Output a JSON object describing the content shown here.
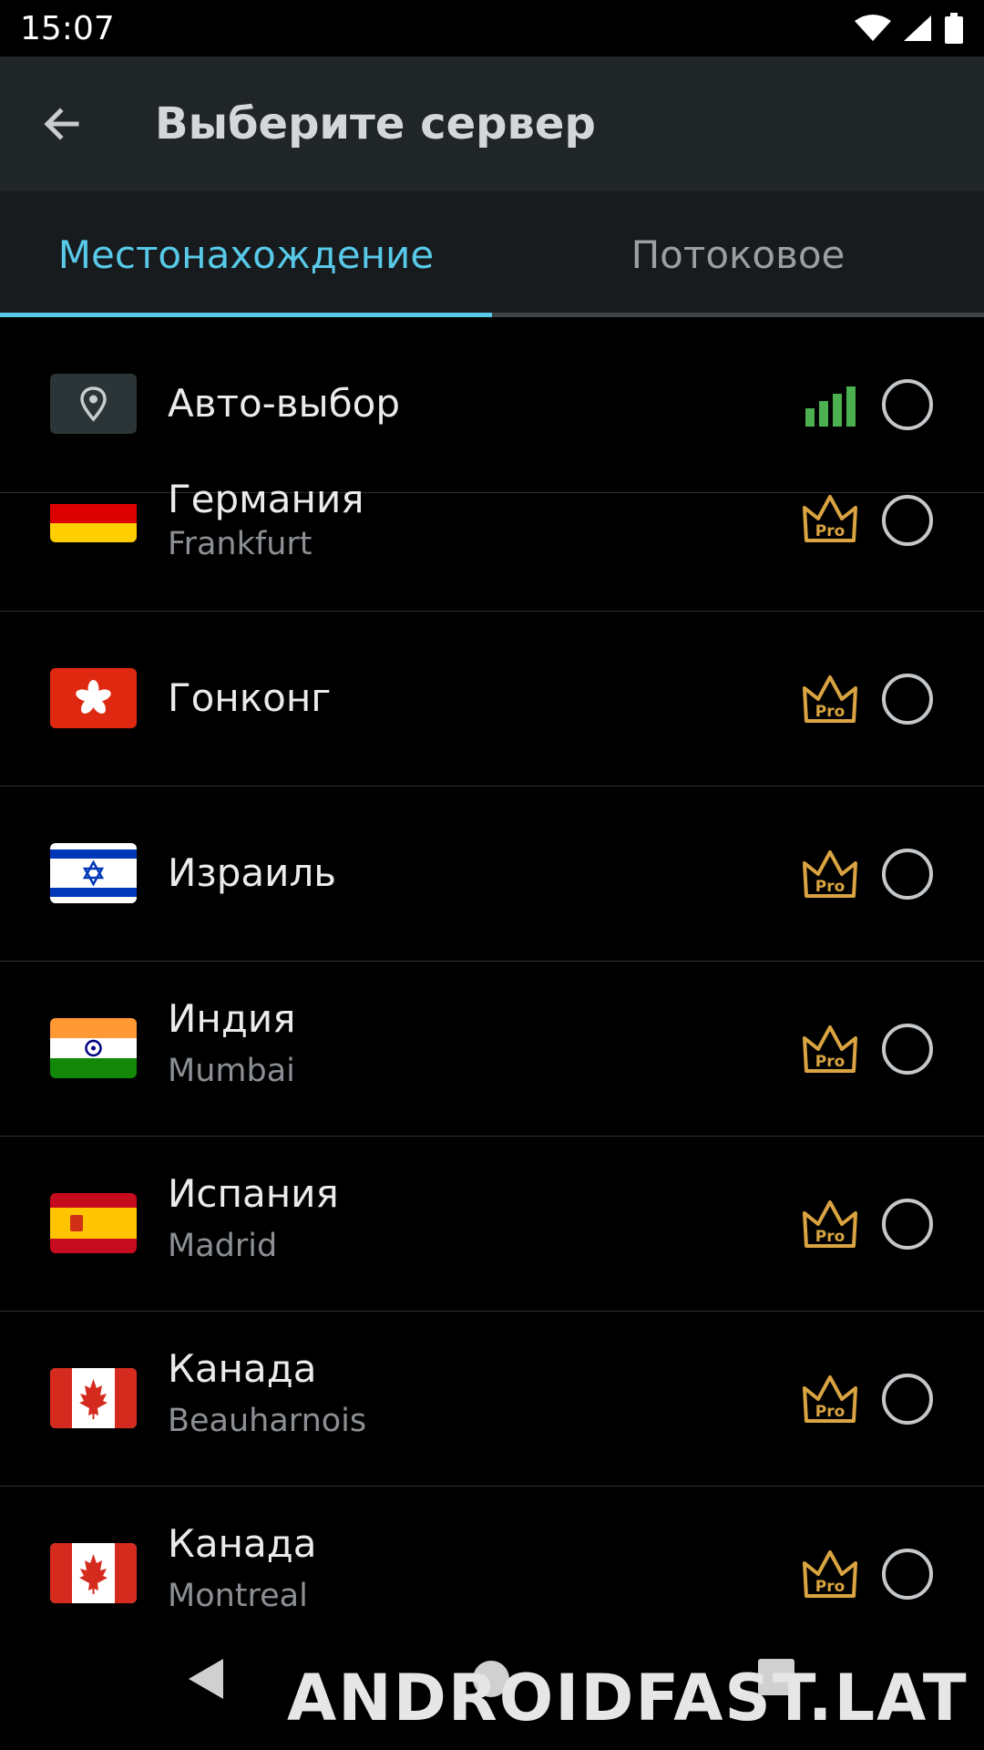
{
  "status_bar": {
    "time": "15:07",
    "icons": [
      "wifi-icon",
      "cell-signal-icon",
      "battery-icon"
    ]
  },
  "app_bar": {
    "title": "Выберите сервер",
    "back_icon": "arrow-left-icon"
  },
  "tabs": [
    {
      "label": "Местонахождение",
      "active": true
    },
    {
      "label": "Потоковое",
      "active": false
    }
  ],
  "auto_select": {
    "label": "Авто-выбор",
    "icon": "location-pin-icon",
    "status_icon": "signal-bars-icon"
  },
  "servers": [
    {
      "country": "Германия",
      "city": "Frankfurt",
      "flag": "germany-flag",
      "badge": "Pro"
    },
    {
      "country": "Гонконг",
      "city": "",
      "flag": "hong-kong-flag",
      "badge": "Pro"
    },
    {
      "country": "Израиль",
      "city": "",
      "flag": "israel-flag",
      "badge": "Pro"
    },
    {
      "country": "Индия",
      "city": "Mumbai",
      "flag": "india-flag",
      "badge": "Pro"
    },
    {
      "country": "Испания",
      "city": "Madrid",
      "flag": "spain-flag",
      "badge": "Pro"
    },
    {
      "country": "Канада",
      "city": "Beauharnois",
      "flag": "canada-flag",
      "badge": "Pro"
    },
    {
      "country": "Канада",
      "city": "Montreal",
      "flag": "canada-flag",
      "badge": "Pro"
    }
  ],
  "colors": {
    "accent": "#58c9e8",
    "pro_gold": "#d9a441",
    "signal_green": "#4caf50",
    "app_bar": "#202528"
  },
  "watermark": "ANDROIDFAST.LAT"
}
